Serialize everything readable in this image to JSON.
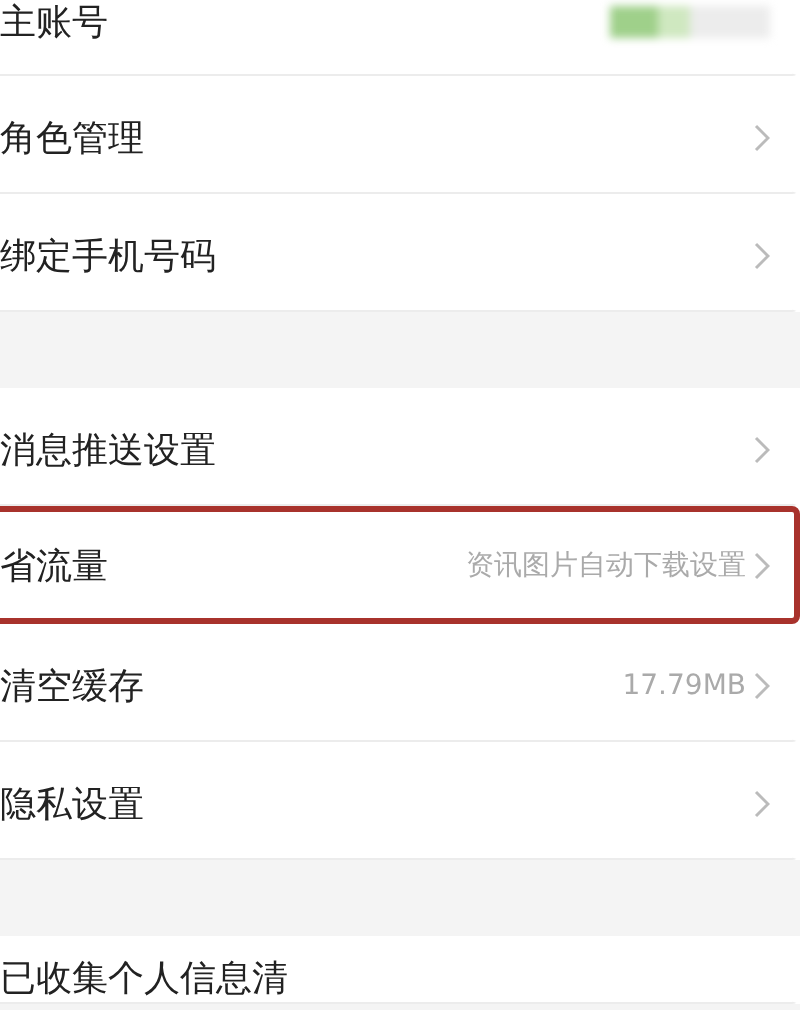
{
  "sections": [
    {
      "rows": [
        {
          "label": "主账号",
          "kind": "blurred",
          "highlighted": false
        },
        {
          "label": "角色管理",
          "kind": "link",
          "highlighted": false
        },
        {
          "label": "绑定手机号码",
          "kind": "link",
          "highlighted": false
        }
      ]
    },
    {
      "rows": [
        {
          "label": "消息推送设置",
          "kind": "link",
          "highlighted": false
        },
        {
          "label": "省流量",
          "value": "资讯图片自动下载设置",
          "kind": "link",
          "highlighted": true
        },
        {
          "label": "清空缓存",
          "value": "17.79MB",
          "kind": "link",
          "highlighted": false
        },
        {
          "label": "隐私设置",
          "kind": "link",
          "highlighted": false
        }
      ]
    },
    {
      "rows": [
        {
          "label": "已收集个人信息清",
          "kind": "plain",
          "highlighted": false
        }
      ]
    }
  ]
}
